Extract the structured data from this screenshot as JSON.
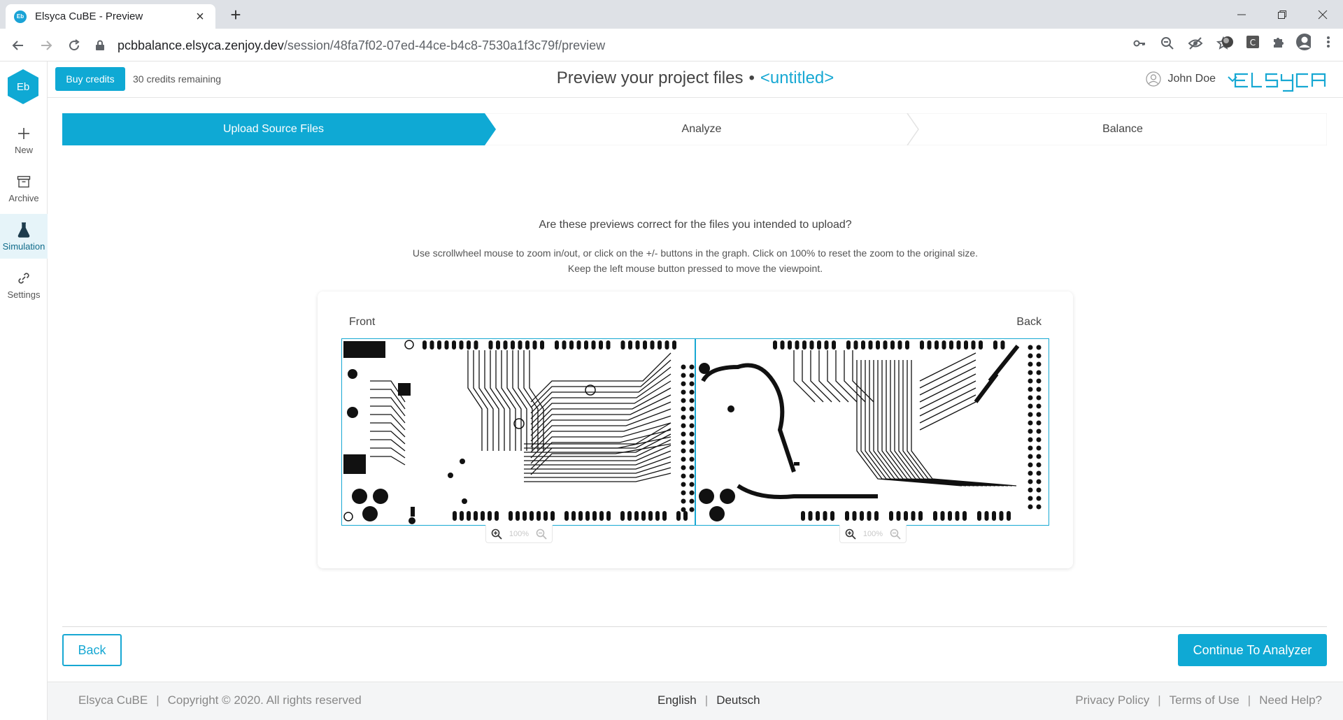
{
  "browser": {
    "tab_title": "Elsyca CuBE - Preview",
    "favicon_text": "Eb",
    "url_host": "pcbbalance.elsyca.zenjoy.dev",
    "url_path": "/session/48fa7f02-07ed-44ce-b4c8-7530a1f3c79f/preview"
  },
  "sidebar": {
    "logo_text": "Eb",
    "items": [
      {
        "label": "New",
        "icon": "plus-icon"
      },
      {
        "label": "Archive",
        "icon": "archive-icon"
      },
      {
        "label": "Simulation",
        "icon": "flask-icon",
        "active": true
      },
      {
        "label": "Settings",
        "icon": "link-icon"
      }
    ]
  },
  "header": {
    "buy_credits": "Buy credits",
    "credits_remaining": "30 credits remaining",
    "title": "Preview your project files",
    "separator": "•",
    "project_name": "<untitled>",
    "user_name": "John Doe",
    "brand": "elsyca"
  },
  "stepper": {
    "steps": [
      {
        "label": "Upload Source Files",
        "active": true
      },
      {
        "label": "Analyze",
        "active": false
      },
      {
        "label": "Balance",
        "active": false
      }
    ]
  },
  "main": {
    "question": "Are these previews correct for the files you intended to upload?",
    "instructions": "Use scrollwheel mouse to zoom in/out, or click on the +/- buttons in the graph. Click on 100% to reset the zoom to the original size. Keep the left mouse button pressed to move the viewpoint.",
    "front_label": "Front",
    "back_label": "Back",
    "front_zoom": "100%",
    "back_zoom": "100%"
  },
  "actions": {
    "back": "Back",
    "continue": "Continue To Analyzer"
  },
  "footer": {
    "product": "Elsyca CuBE",
    "copyright": "Copyright © 2020. All rights reserved",
    "lang_en": "English",
    "lang_de": "Deutsch",
    "privacy": "Privacy Policy",
    "terms": "Terms of Use",
    "help": "Need Help?",
    "sep": "|"
  },
  "colors": {
    "accent": "#0fa9d4",
    "accent_text": "#17a8d3",
    "step_inactive_bg": "#ffffff"
  }
}
